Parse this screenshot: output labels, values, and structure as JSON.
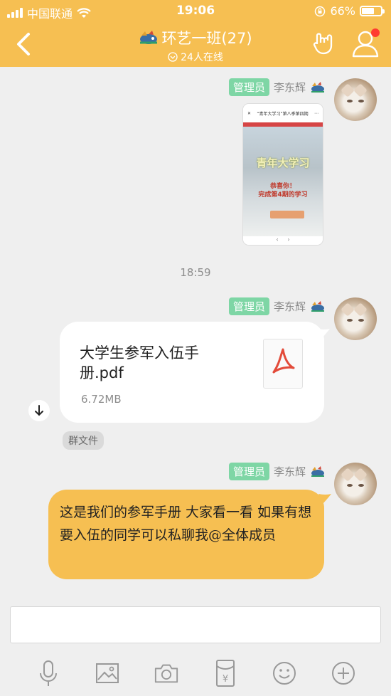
{
  "status_bar": {
    "carrier": "中国联通",
    "time": "19:06",
    "battery_percent_label": "66%",
    "battery_level": 0.66
  },
  "header": {
    "group_name": "环艺一班(27)",
    "online_count": "24人在线"
  },
  "messages": [
    {
      "type": "image",
      "badge": "管理员",
      "sender": "李东辉",
      "image_top_caption": "“青年大学习”第八季第四期",
      "image_headline": "青年大学习",
      "image_sub": "恭喜你！",
      "image_sub2": "完成第4期的学习"
    },
    {
      "type": "timestamp",
      "text": "18:59"
    },
    {
      "type": "file",
      "badge": "管理员",
      "sender": "李东辉",
      "file_name": "大学生参军入伍手册.pdf",
      "file_size": "6.72MB",
      "tag": "群文件"
    },
    {
      "type": "text",
      "badge": "管理员",
      "sender": "李东辉",
      "text": "这是我们的参军手册 大家看一看 如果有想要入伍的同学可以私聊我@全体成员"
    }
  ],
  "colors": {
    "accent": "#f6bf52",
    "badge": "#7ed6a5",
    "background": "#efefef"
  },
  "toolbar": {
    "items": [
      "microphone-icon",
      "image-icon",
      "camera-icon",
      "red-packet-icon",
      "emoji-icon",
      "plus-icon"
    ]
  }
}
